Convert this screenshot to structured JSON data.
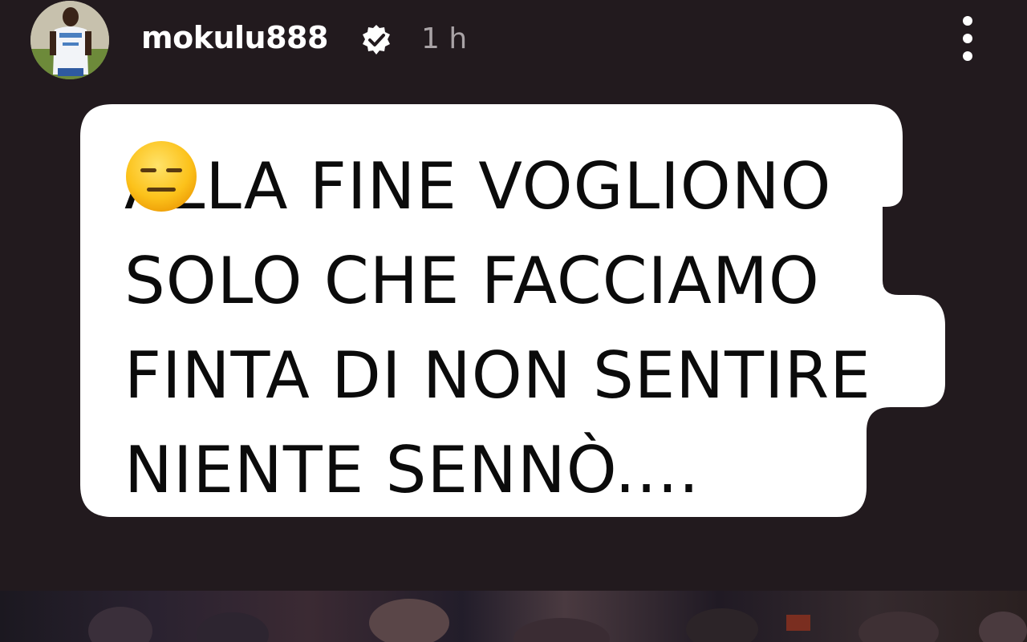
{
  "header": {
    "username": "mokulu888",
    "time_ago": "1 h",
    "verified_icon": "verified-badge-icon",
    "more_icon": "more-vertical-icon"
  },
  "sticker": {
    "lines": [
      "ALLA FINE VOGLIONO",
      "SOLO CHE FACCIAMO",
      "FINTA DI NON SENTIRE",
      "NIENTE SENNÒ...."
    ],
    "emoji": "expressionless-face-emoji"
  },
  "colors": {
    "background": "#221a1e",
    "sticker_fill": "#ffffff",
    "text": "#0b0b0b",
    "timestamp": "#a9a3a6"
  }
}
